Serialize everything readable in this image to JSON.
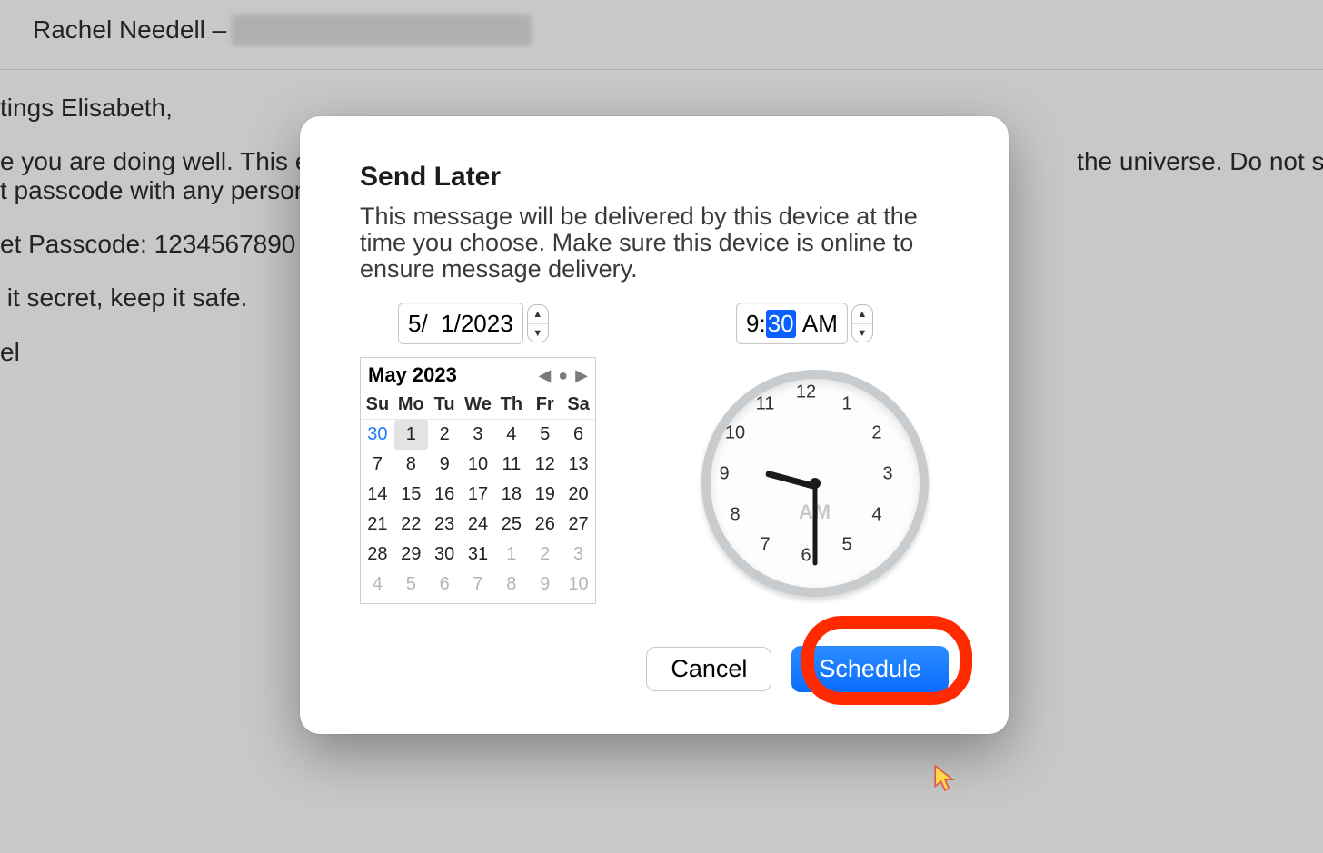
{
  "email": {
    "from_label": ":",
    "from_name": "Rachel Needell –",
    "body_lines": [
      "tings Elisabeth,",
      "e you are doing well. This email                                                                                                      the universe. Do not shar",
      "t passcode with any person on",
      "et Passcode: 1234567890",
      " it secret, keep it safe.",
      "el"
    ]
  },
  "modal": {
    "title": "Send Later",
    "description": "This message will be delivered by this device at the time you choose. Make sure this device is online to ensure message delivery.",
    "date_field": {
      "month": "5",
      "day": "1",
      "year": "2023",
      "display": "5/  1/2023"
    },
    "time_field": {
      "hour": "9",
      "minute": "30",
      "ampm": "AM"
    },
    "calendar": {
      "title": "May 2023",
      "dow": [
        "Su",
        "Mo",
        "Tu",
        "We",
        "Th",
        "Fr",
        "Sa"
      ],
      "days": [
        {
          "n": "30",
          "cls": "prev-month"
        },
        {
          "n": "1",
          "cls": "selected"
        },
        {
          "n": "2"
        },
        {
          "n": "3"
        },
        {
          "n": "4"
        },
        {
          "n": "5"
        },
        {
          "n": "6"
        },
        {
          "n": "7"
        },
        {
          "n": "8"
        },
        {
          "n": "9"
        },
        {
          "n": "10"
        },
        {
          "n": "11"
        },
        {
          "n": "12"
        },
        {
          "n": "13"
        },
        {
          "n": "14"
        },
        {
          "n": "15"
        },
        {
          "n": "16"
        },
        {
          "n": "17"
        },
        {
          "n": "18"
        },
        {
          "n": "19"
        },
        {
          "n": "20"
        },
        {
          "n": "21"
        },
        {
          "n": "22"
        },
        {
          "n": "23"
        },
        {
          "n": "24"
        },
        {
          "n": "25"
        },
        {
          "n": "26"
        },
        {
          "n": "27"
        },
        {
          "n": "28"
        },
        {
          "n": "29"
        },
        {
          "n": "30"
        },
        {
          "n": "31"
        },
        {
          "n": "1",
          "cls": "other"
        },
        {
          "n": "2",
          "cls": "other"
        },
        {
          "n": "3",
          "cls": "other"
        },
        {
          "n": "4",
          "cls": "other"
        },
        {
          "n": "5",
          "cls": "other"
        },
        {
          "n": "6",
          "cls": "other"
        },
        {
          "n": "7",
          "cls": "other"
        },
        {
          "n": "8",
          "cls": "other"
        },
        {
          "n": "9",
          "cls": "other"
        },
        {
          "n": "10",
          "cls": "other"
        }
      ]
    },
    "clock": {
      "numbers": [
        "12",
        "1",
        "2",
        "3",
        "4",
        "5",
        "6",
        "7",
        "8",
        "9",
        "10",
        "11"
      ],
      "ampm": "AM",
      "hour_angle": 195,
      "minute_angle": 90
    },
    "buttons": {
      "cancel": "Cancel",
      "schedule": "Schedule"
    }
  }
}
